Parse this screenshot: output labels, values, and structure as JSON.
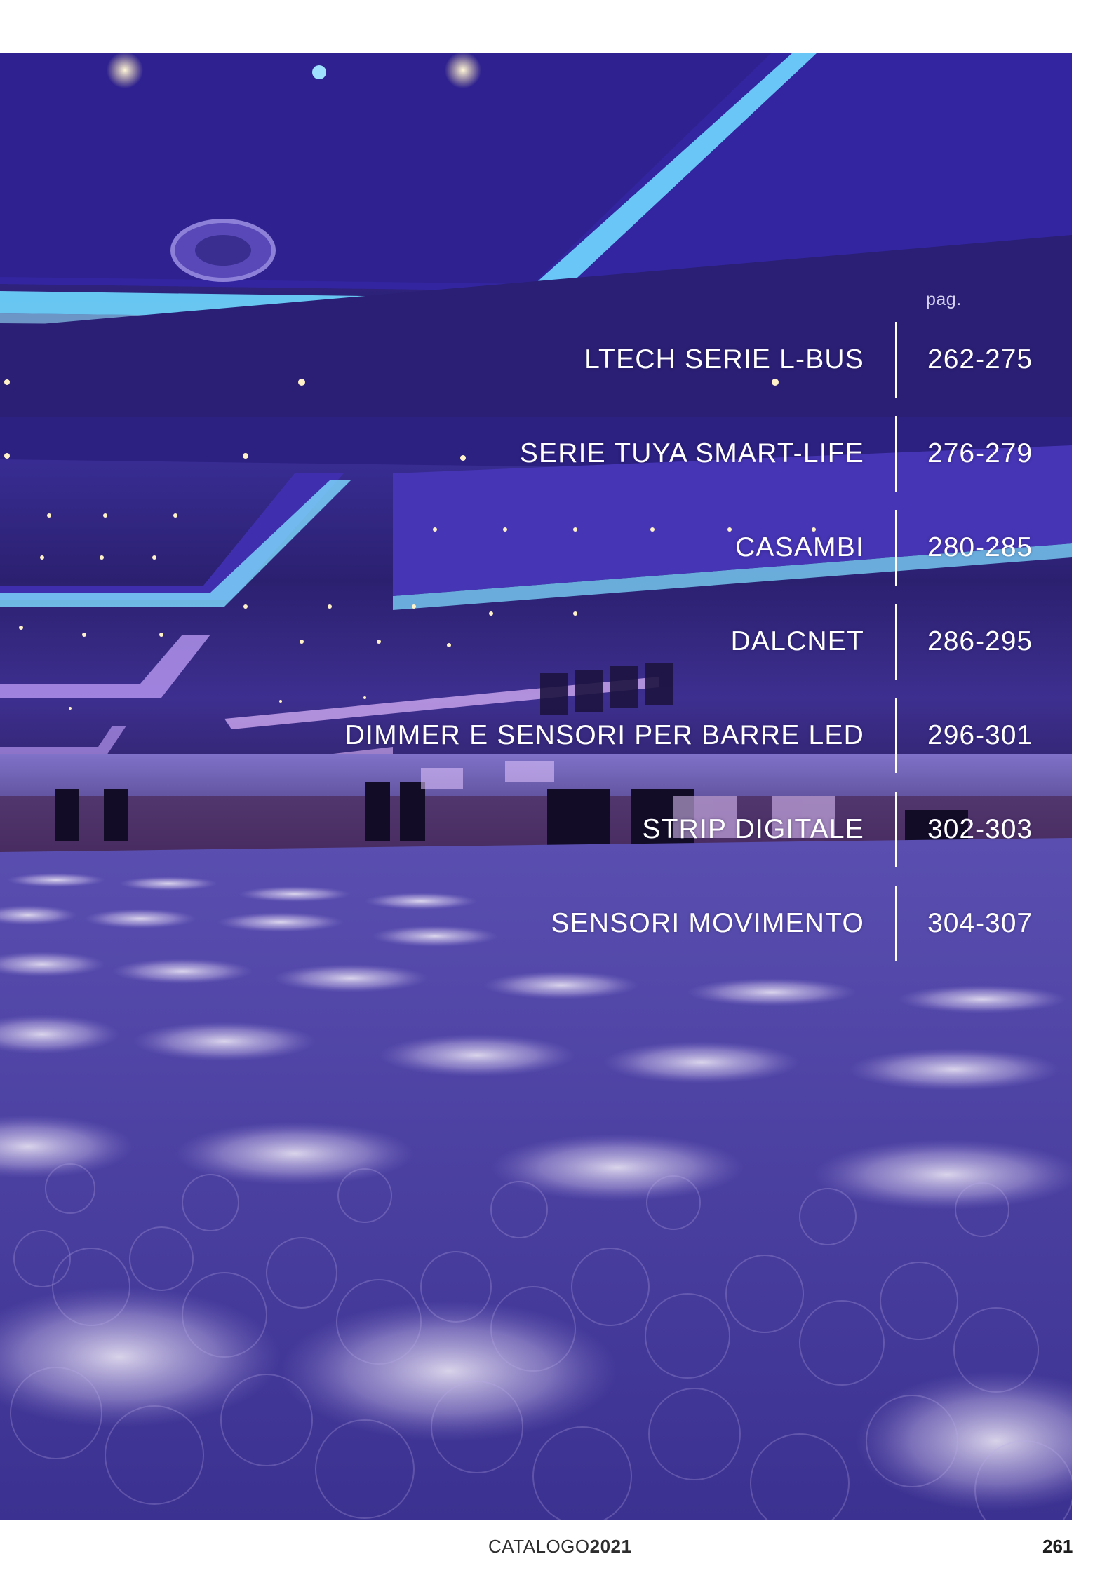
{
  "toc": {
    "pag_label": "pag.",
    "items": [
      {
        "label": "LTECH SERIE L-BUS",
        "pages": "262-275"
      },
      {
        "label": "SERIE TUYA SMART-LIFE",
        "pages": "276-279"
      },
      {
        "label": "CASAMBI",
        "pages": "280-285"
      },
      {
        "label": "DALCNET",
        "pages": "286-295"
      },
      {
        "label": "DIMMER E SENSORI PER BARRE LED",
        "pages": "296-301"
      },
      {
        "label": "STRIP DIGITALE",
        "pages": "302-303"
      },
      {
        "label": "SENSORI MOVIMENTO",
        "pages": "304-307"
      }
    ]
  },
  "footer": {
    "catalog_prefix": "CATALOGO",
    "catalog_year": "2021",
    "page_number": "261"
  },
  "colors": {
    "photo_purple": "#3a2c97",
    "cove_light_cyan": "#6fd8ff",
    "text_white": "#ffffff"
  }
}
